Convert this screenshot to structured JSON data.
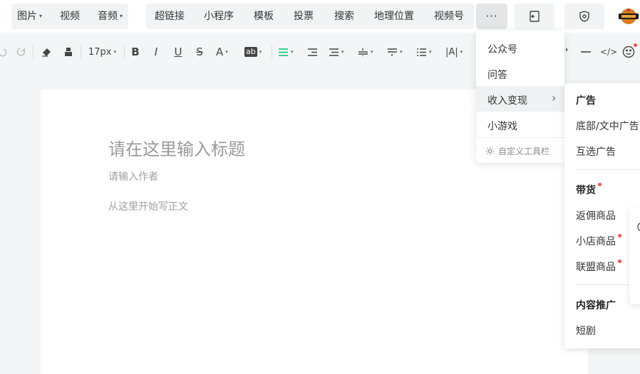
{
  "topbar": {
    "group1": [
      {
        "label": "图片",
        "caret": "▾"
      },
      {
        "label": "视频",
        "caret": ""
      },
      {
        "label": "音频",
        "caret": "▾"
      }
    ],
    "group2": [
      {
        "label": "超链接"
      },
      {
        "label": "小程序"
      },
      {
        "label": "模板"
      },
      {
        "label": "投票"
      },
      {
        "label": "搜索"
      },
      {
        "label": "地理位置"
      },
      {
        "label": "视频号"
      }
    ],
    "more_label": "···"
  },
  "toolbar": {
    "font_size": "17px",
    "caret": "▾",
    "bold": "B",
    "italic": "I",
    "underline": "U",
    "strike": "S",
    "font_color": "A",
    "bg_color": "ab",
    "letter_spacing": "|A|",
    "code": "</>"
  },
  "editor": {
    "title_placeholder": "请在这里输入标题",
    "author_placeholder": "请输入作者",
    "body_placeholder": "从这里开始写正文"
  },
  "more_menu": {
    "items": [
      "公众号",
      "问答",
      "收入变现",
      "小游戏"
    ],
    "chevron": "›",
    "customize": "自定义工具栏"
  },
  "submenu": {
    "sections": [
      {
        "header": "广告",
        "items": [
          "底部/文中广告",
          "互选广告"
        ]
      },
      {
        "header": "带货",
        "items": [
          "返佣商品",
          "小店商品",
          "联盟商品"
        ]
      },
      {
        "header": "内容推广",
        "items": [
          "短剧"
        ]
      }
    ]
  },
  "colors": {
    "accent": "#07c160",
    "badge": "#fa5151"
  }
}
